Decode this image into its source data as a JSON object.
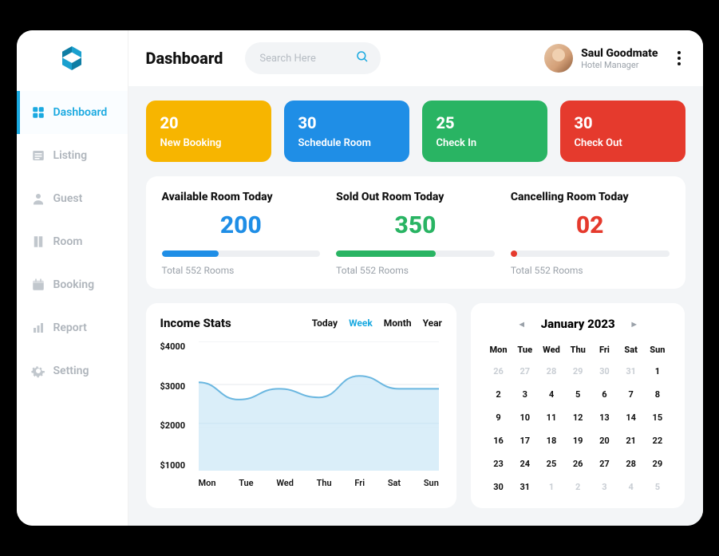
{
  "header": {
    "title": "Dashboard",
    "search_placeholder": "Search Here",
    "user_name": "Saul Goodmate",
    "user_role": "Hotel Manager"
  },
  "sidebar": {
    "items": [
      {
        "icon": "grid",
        "label": "Dashboard",
        "active": true
      },
      {
        "icon": "list",
        "label": "Listing",
        "active": false
      },
      {
        "icon": "user",
        "label": "Guest",
        "active": false
      },
      {
        "icon": "door",
        "label": "Room",
        "active": false
      },
      {
        "icon": "calendar",
        "label": "Booking",
        "active": false
      },
      {
        "icon": "bars",
        "label": "Report",
        "active": false
      },
      {
        "icon": "gear",
        "label": "Setting",
        "active": false
      }
    ]
  },
  "stat_cards": [
    {
      "value": "20",
      "label": "New Booking",
      "color": "c-yellow"
    },
    {
      "value": "30",
      "label": "Schedule Room",
      "color": "c-blue"
    },
    {
      "value": "25",
      "label": "Check In",
      "color": "c-green"
    },
    {
      "value": "30",
      "label": "Check Out",
      "color": "c-red"
    }
  ],
  "today": [
    {
      "title": "Available Room Today",
      "value": "200",
      "color": "blue",
      "pct": 36,
      "sub": "Total 552 Rooms"
    },
    {
      "title": "Sold Out Room Today",
      "value": "350",
      "color": "green",
      "pct": 63,
      "sub": "Total 552 Rooms"
    },
    {
      "title": "Cancelling Room Today",
      "value": "02",
      "color": "red",
      "pct": 4,
      "sub": "Total 552 Rooms"
    }
  ],
  "income": {
    "title": "Income Stats",
    "ranges": [
      "Today",
      "Week",
      "Month",
      "Year"
    ],
    "active_range": "Week"
  },
  "chart_data": {
    "type": "area",
    "title": "Income Stats",
    "xlabel": "",
    "ylabel": "",
    "ylim": [
      1000,
      4000
    ],
    "yticks": [
      "$4000",
      "$3000",
      "$2000",
      "$1000"
    ],
    "categories": [
      "Mon",
      "Tue",
      "Wed",
      "Thu",
      "Fri",
      "Sat",
      "Sun"
    ],
    "series": [
      {
        "name": "Income",
        "values": [
          3050,
          2650,
          2900,
          2700,
          3200,
          2900,
          2900
        ]
      }
    ],
    "baseline": 2100
  },
  "calendar": {
    "month_title": "January 2023",
    "dow": [
      "Mon",
      "Tue",
      "Wed",
      "Thu",
      "Fri",
      "Sat",
      "Sun"
    ],
    "leading_muted": [
      "26",
      "27",
      "28",
      "29",
      "30",
      "31"
    ],
    "days": [
      "1",
      "2",
      "3",
      "4",
      "5",
      "6",
      "7",
      "8",
      "9",
      "10",
      "11",
      "12",
      "13",
      "14",
      "15",
      "16",
      "17",
      "18",
      "19",
      "20",
      "21",
      "22",
      "23",
      "24",
      "25",
      "26",
      "27",
      "28",
      "29",
      "30",
      "31"
    ],
    "trailing_muted": [
      "1",
      "2",
      "3",
      "4",
      "5"
    ]
  }
}
